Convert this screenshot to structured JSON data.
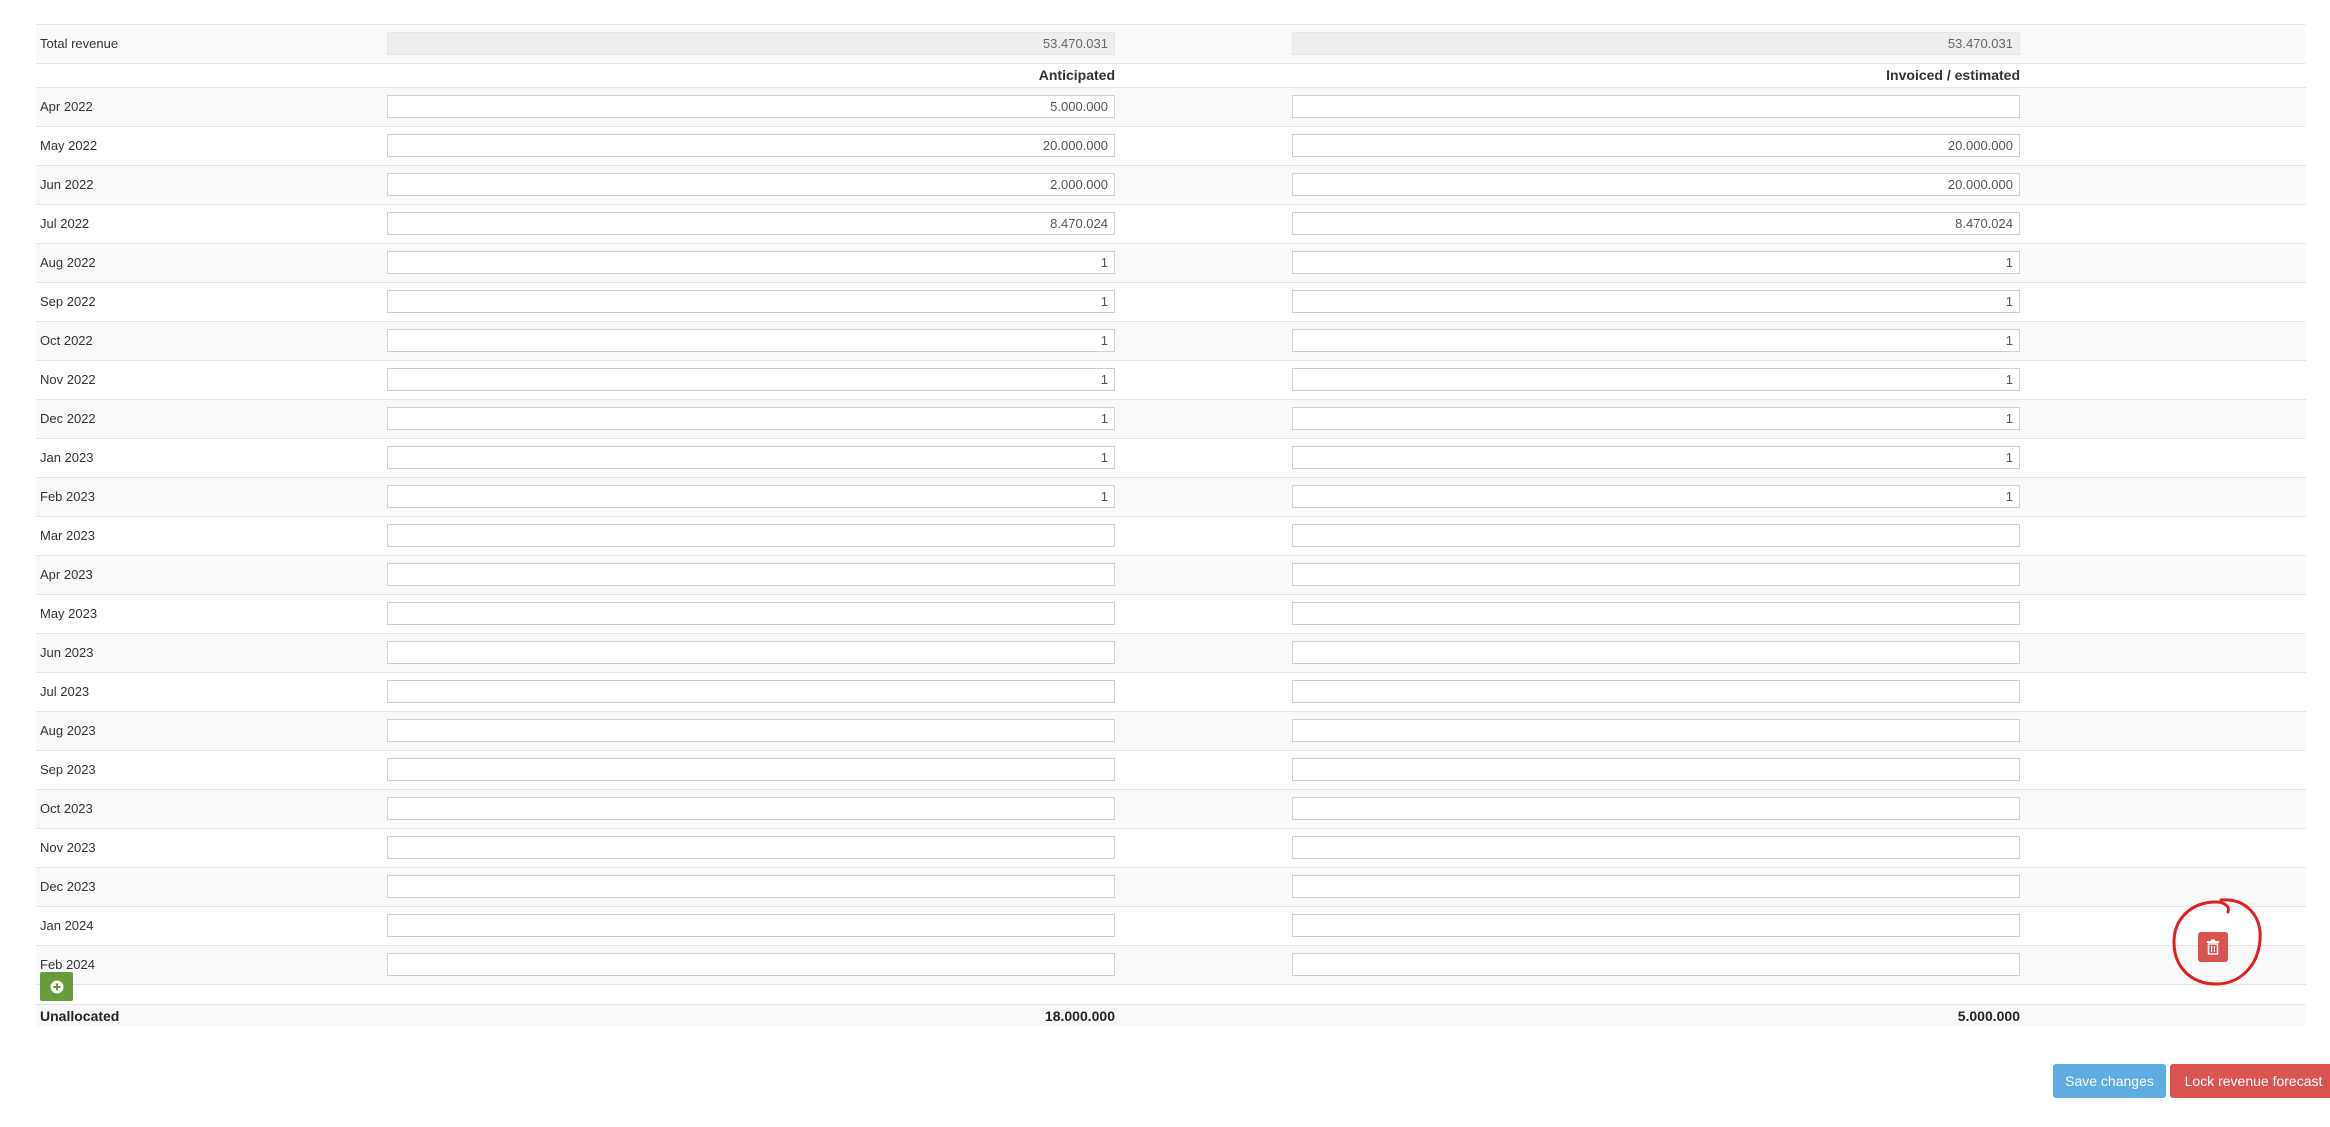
{
  "total": {
    "label": "Total revenue",
    "anticipated": "53.470.031",
    "invoiced": "53.470.031"
  },
  "headers": {
    "anticipated": "Anticipated",
    "invoiced": "Invoiced / estimated"
  },
  "rows": [
    {
      "month": "Apr 2022",
      "anticipated": "5.000.000",
      "invoiced": ""
    },
    {
      "month": "May 2022",
      "anticipated": "20.000.000",
      "invoiced": "20.000.000"
    },
    {
      "month": "Jun 2022",
      "anticipated": "2.000.000",
      "invoiced": "20.000.000"
    },
    {
      "month": "Jul 2022",
      "anticipated": "8.470.024",
      "invoiced": "8.470.024"
    },
    {
      "month": "Aug 2022",
      "anticipated": "1",
      "invoiced": "1"
    },
    {
      "month": "Sep 2022",
      "anticipated": "1",
      "invoiced": "1"
    },
    {
      "month": "Oct 2022",
      "anticipated": "1",
      "invoiced": "1"
    },
    {
      "month": "Nov 2022",
      "anticipated": "1",
      "invoiced": "1"
    },
    {
      "month": "Dec 2022",
      "anticipated": "1",
      "invoiced": "1"
    },
    {
      "month": "Jan 2023",
      "anticipated": "1",
      "invoiced": "1"
    },
    {
      "month": "Feb 2023",
      "anticipated": "1",
      "invoiced": "1"
    },
    {
      "month": "Mar 2023",
      "anticipated": "",
      "invoiced": ""
    },
    {
      "month": "Apr 2023",
      "anticipated": "",
      "invoiced": ""
    },
    {
      "month": "May 2023",
      "anticipated": "",
      "invoiced": ""
    },
    {
      "month": "Jun 2023",
      "anticipated": "",
      "invoiced": ""
    },
    {
      "month": "Jul 2023",
      "anticipated": "",
      "invoiced": ""
    },
    {
      "month": "Aug 2023",
      "anticipated": "",
      "invoiced": ""
    },
    {
      "month": "Sep 2023",
      "anticipated": "",
      "invoiced": ""
    },
    {
      "month": "Oct 2023",
      "anticipated": "",
      "invoiced": ""
    },
    {
      "month": "Nov 2023",
      "anticipated": "",
      "invoiced": ""
    },
    {
      "month": "Dec 2023",
      "anticipated": "",
      "invoiced": ""
    },
    {
      "month": "Jan 2024",
      "anticipated": "",
      "invoiced": ""
    },
    {
      "month": "Feb 2024",
      "anticipated": "",
      "invoiced": ""
    }
  ],
  "unallocated": {
    "label": "Unallocated",
    "anticipated": "18.000.000",
    "invoiced": "5.000.000"
  },
  "buttons": {
    "save": "Save changes",
    "lock": "Lock revenue forecast"
  },
  "icons": {
    "add": "plus-circle-icon",
    "delete": "trash-icon"
  },
  "colors": {
    "add": "#6b9a3a",
    "delete": "#d9534f",
    "save": "#5dade2",
    "lock": "#d9534f",
    "annotation": "#e02020"
  }
}
